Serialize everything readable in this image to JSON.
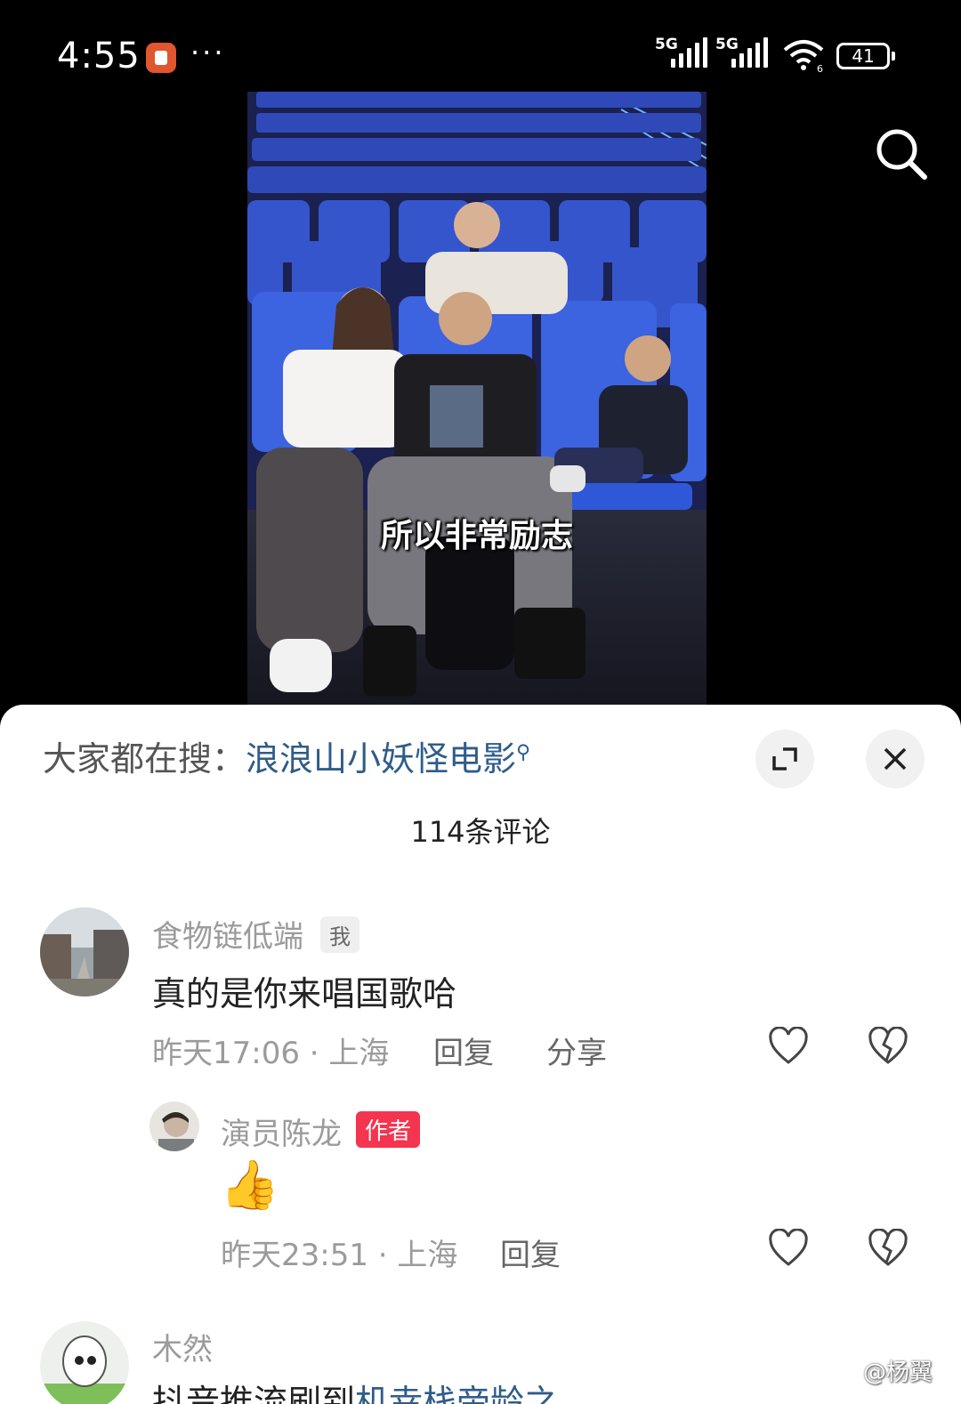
{
  "status_bar": {
    "time": "4:55",
    "more": "···",
    "network1": "5G",
    "network2": "5G",
    "battery": "41",
    "wifi_sub": "6"
  },
  "video": {
    "caption": "所以非常励志"
  },
  "sheet": {
    "hot_search_prefix": "大家都在搜：",
    "hot_search_link": "浪浪山小妖怪电影",
    "comment_count": "114条评论"
  },
  "comments": [
    {
      "username": "食物链低端",
      "tag": "我",
      "text": "真的是你来唱国歌哈",
      "meta": "昨天17:06 · 上海",
      "reply": "回复",
      "share": "分享"
    }
  ],
  "reply": {
    "username": "演员陈龙",
    "tag": "作者",
    "emoji": "👍",
    "meta": "昨天23:51 · 上海",
    "reply": "回复"
  },
  "comment3": {
    "username": "木然",
    "text_partial": "抖音推流刷到",
    "link_partial": "机幸栈帝龄之"
  },
  "watermark": "@杨翼",
  "colors": {
    "link": "#2f5c8a",
    "author_tag": "#f5344f",
    "muted": "#9b9b9b"
  }
}
